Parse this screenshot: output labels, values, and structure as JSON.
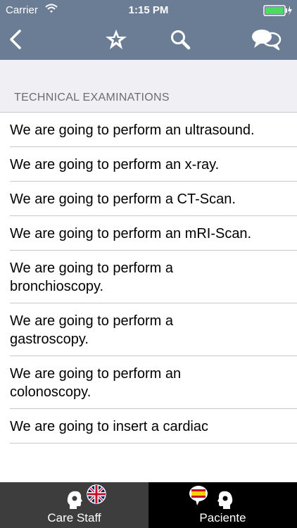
{
  "status_bar": {
    "carrier": "Carrier",
    "time": "1:15 PM"
  },
  "nav": {
    "back_icon": "chevron-left-icon",
    "favorite_icon": "star-icon",
    "search_icon": "search-icon",
    "chat_icon": "speech-bubbles-icon"
  },
  "section": {
    "header": "TECHNICAL EXAMINATIONS"
  },
  "phrases": [
    "We are going to perform an ultrasound.",
    "We are going to perform an x-ray.",
    "We are going to perform a CT-Scan.",
    "We are going to perform an mRI-Scan.",
    "We are going to perform a bronchioscopy.",
    "We are going to perform a gastroscopy.",
    "We are going to perform an colonoscopy.",
    "We are going to insert a cardiac"
  ],
  "tabs": {
    "care_staff": "Care Staff",
    "patient": "Paciente"
  },
  "colors": {
    "nav_background": "#6b7d95",
    "care_tab_background": "#3d3d3d",
    "patient_tab_background": "#000000",
    "battery": "#4cd964"
  }
}
